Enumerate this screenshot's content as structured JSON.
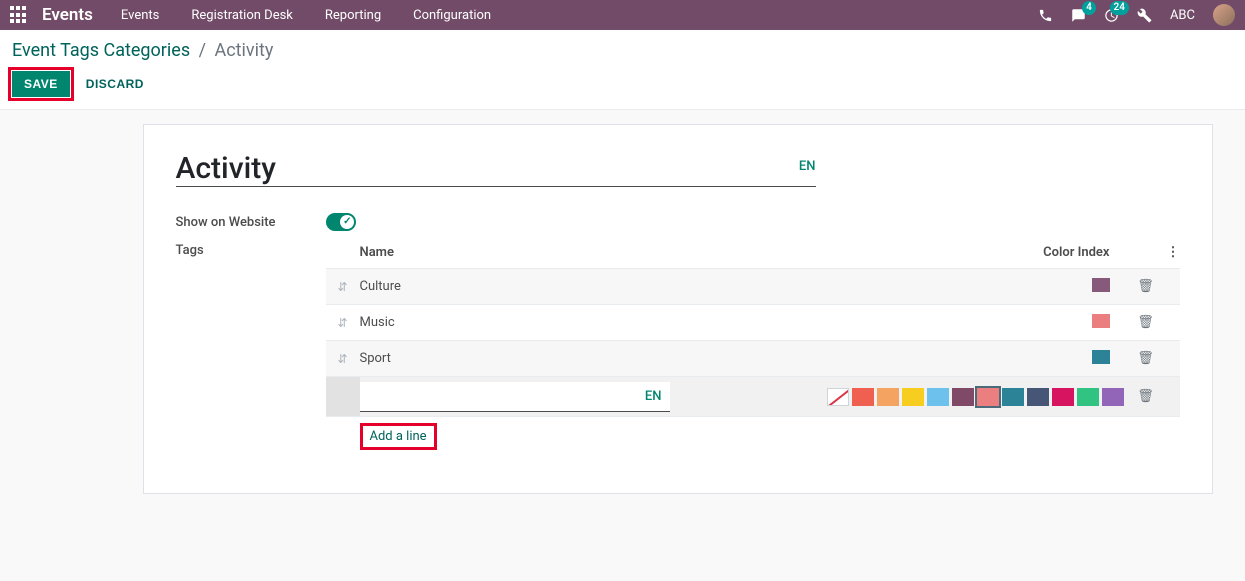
{
  "nav": {
    "brand": "Events",
    "items": [
      "Events",
      "Registration Desk",
      "Reporting",
      "Configuration"
    ],
    "msg_count": "4",
    "activity_count": "24",
    "user": "ABC"
  },
  "breadcrumb": {
    "root": "Event Tags Categories",
    "current": "Activity"
  },
  "actions": {
    "save": "SAVE",
    "discard": "DISCARD"
  },
  "form": {
    "title": "Activity",
    "lang": "EN",
    "show_on_website_label": "Show on Website",
    "tags_label": "Tags"
  },
  "table": {
    "headers": {
      "name": "Name",
      "color": "Color Index"
    },
    "rows": [
      {
        "name": "Culture",
        "color": "#875A7B"
      },
      {
        "name": "Music",
        "color": "#EB7E7F"
      },
      {
        "name": "Sport",
        "color": "#2C8397"
      }
    ],
    "edit_lang": "EN",
    "palette": [
      "#F06050",
      "#F4A460",
      "#F7CD1F",
      "#6CC1ED",
      "#814968",
      "#EB7E7F",
      "#2C8397",
      "#475577",
      "#D6145F",
      "#30C381",
      "#9365B8"
    ],
    "selected_palette_index": 5,
    "add_line": "Add a line"
  }
}
